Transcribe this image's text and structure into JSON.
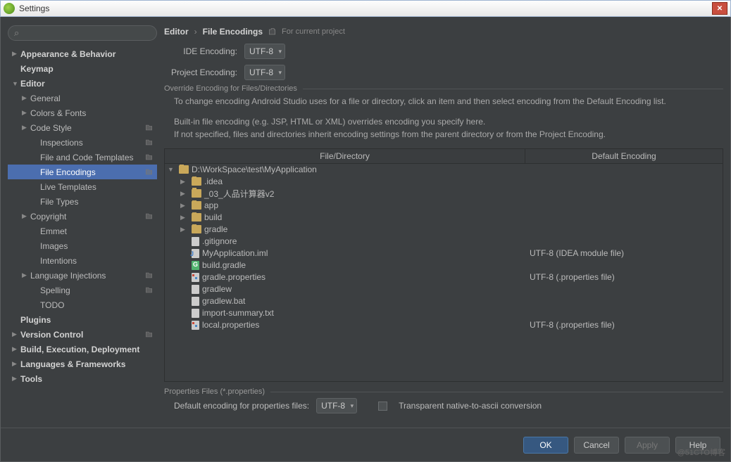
{
  "window": {
    "title": "Settings"
  },
  "search": {
    "placeholder": ""
  },
  "sidebar": [
    {
      "label": "Appearance & Behavior",
      "bold": true,
      "indent": 0,
      "arrow": "▶",
      "tag": false
    },
    {
      "label": "Keymap",
      "bold": true,
      "indent": 0,
      "arrow": "",
      "tag": false
    },
    {
      "label": "Editor",
      "bold": true,
      "indent": 0,
      "arrow": "▼",
      "tag": false
    },
    {
      "label": "General",
      "bold": false,
      "indent": 1,
      "arrow": "▶",
      "tag": false
    },
    {
      "label": "Colors & Fonts",
      "bold": false,
      "indent": 1,
      "arrow": "▶",
      "tag": false
    },
    {
      "label": "Code Style",
      "bold": false,
      "indent": 1,
      "arrow": "▶",
      "tag": true
    },
    {
      "label": "Inspections",
      "bold": false,
      "indent": 2,
      "arrow": "",
      "tag": true
    },
    {
      "label": "File and Code Templates",
      "bold": false,
      "indent": 2,
      "arrow": "",
      "tag": true
    },
    {
      "label": "File Encodings",
      "bold": false,
      "indent": 2,
      "arrow": "",
      "tag": true,
      "selected": true
    },
    {
      "label": "Live Templates",
      "bold": false,
      "indent": 2,
      "arrow": "",
      "tag": false
    },
    {
      "label": "File Types",
      "bold": false,
      "indent": 2,
      "arrow": "",
      "tag": false
    },
    {
      "label": "Copyright",
      "bold": false,
      "indent": 1,
      "arrow": "▶",
      "tag": true
    },
    {
      "label": "Emmet",
      "bold": false,
      "indent": 2,
      "arrow": "",
      "tag": false
    },
    {
      "label": "Images",
      "bold": false,
      "indent": 2,
      "arrow": "",
      "tag": false
    },
    {
      "label": "Intentions",
      "bold": false,
      "indent": 2,
      "arrow": "",
      "tag": false
    },
    {
      "label": "Language Injections",
      "bold": false,
      "indent": 1,
      "arrow": "▶",
      "tag": true
    },
    {
      "label": "Spelling",
      "bold": false,
      "indent": 2,
      "arrow": "",
      "tag": true
    },
    {
      "label": "TODO",
      "bold": false,
      "indent": 2,
      "arrow": "",
      "tag": false
    },
    {
      "label": "Plugins",
      "bold": true,
      "indent": 0,
      "arrow": "",
      "tag": false
    },
    {
      "label": "Version Control",
      "bold": true,
      "indent": 0,
      "arrow": "▶",
      "tag": true
    },
    {
      "label": "Build, Execution, Deployment",
      "bold": true,
      "indent": 0,
      "arrow": "▶",
      "tag": false
    },
    {
      "label": "Languages & Frameworks",
      "bold": true,
      "indent": 0,
      "arrow": "▶",
      "tag": false
    },
    {
      "label": "Tools",
      "bold": true,
      "indent": 0,
      "arrow": "▶",
      "tag": false
    }
  ],
  "breadcrumb": {
    "parent": "Editor",
    "current": "File Encodings",
    "scope": "For current project"
  },
  "ide_encoding": {
    "label": "IDE Encoding:",
    "value": "UTF-8"
  },
  "project_encoding": {
    "label": "Project Encoding:",
    "value": "UTF-8"
  },
  "override": {
    "title": "Override Encoding for Files/Directories",
    "hint1": "To change encoding Android Studio uses for a file or directory, click an item and then select encoding from the Default Encoding list.",
    "hint2": "Built-in file encoding (e.g. JSP, HTML or XML) overrides encoding you specify here.",
    "hint3": "If not specified, files and directories inherit encoding settings from the parent directory or from the Project Encoding."
  },
  "table": {
    "headers": {
      "c1": "File/Directory",
      "c2": "Default Encoding"
    },
    "rows": [
      {
        "arrow": "▼",
        "indent": 0,
        "icon": "folder",
        "name": "D:\\WorkSpace\\test\\MyApplication",
        "enc": ""
      },
      {
        "arrow": "▶",
        "indent": 1,
        "icon": "folder",
        "name": ".idea",
        "enc": ""
      },
      {
        "arrow": "▶",
        "indent": 1,
        "icon": "folder",
        "name": "_03_人品计算器v2",
        "enc": ""
      },
      {
        "arrow": "▶",
        "indent": 1,
        "icon": "folder",
        "name": "app",
        "enc": ""
      },
      {
        "arrow": "▶",
        "indent": 1,
        "icon": "folder",
        "name": "build",
        "enc": ""
      },
      {
        "arrow": "▶",
        "indent": 1,
        "icon": "folder",
        "name": "gradle",
        "enc": ""
      },
      {
        "arrow": "",
        "indent": 1,
        "icon": "file",
        "name": ".gitignore",
        "enc": ""
      },
      {
        "arrow": "",
        "indent": 1,
        "icon": "iml",
        "name": "MyApplication.iml",
        "enc": "UTF-8 (IDEA module file)"
      },
      {
        "arrow": "",
        "indent": 1,
        "icon": "gradle",
        "name": "build.gradle",
        "enc": ""
      },
      {
        "arrow": "",
        "indent": 1,
        "icon": "props",
        "name": "gradle.properties",
        "enc": "UTF-8 (.properties file)"
      },
      {
        "arrow": "",
        "indent": 1,
        "icon": "file",
        "name": "gradlew",
        "enc": ""
      },
      {
        "arrow": "",
        "indent": 1,
        "icon": "file",
        "name": "gradlew.bat",
        "enc": ""
      },
      {
        "arrow": "",
        "indent": 1,
        "icon": "file",
        "name": "import-summary.txt",
        "enc": ""
      },
      {
        "arrow": "",
        "indent": 1,
        "icon": "props",
        "name": "local.properties",
        "enc": "UTF-8 (.properties file)"
      }
    ]
  },
  "props_section": {
    "title": "Properties Files (*.properties)",
    "label": "Default encoding for properties files:",
    "value": "UTF-8",
    "checkbox_label": "Transparent native-to-ascii conversion"
  },
  "buttons": {
    "ok": "OK",
    "cancel": "Cancel",
    "apply": "Apply",
    "help": "Help"
  },
  "watermark": "@51CTO博客"
}
